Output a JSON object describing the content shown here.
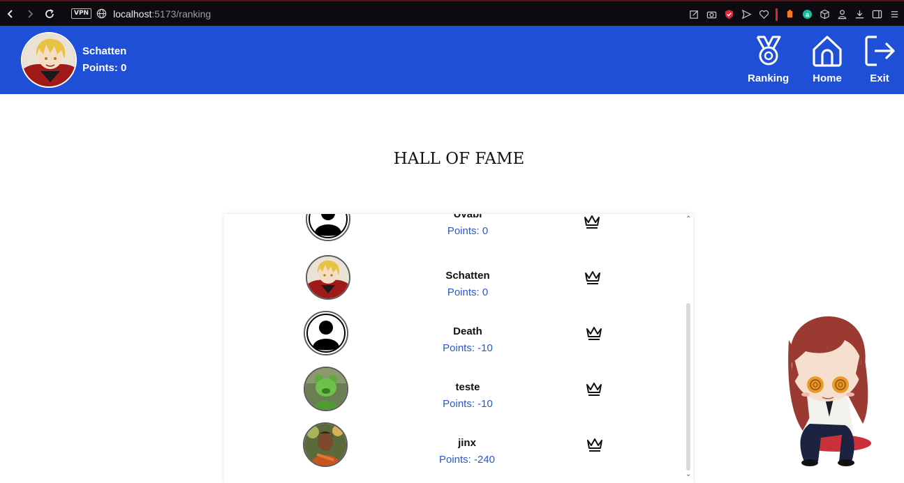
{
  "browser": {
    "vpn_label": "VPN",
    "url_host": "localhost",
    "url_path": ":5173/ranking"
  },
  "header": {
    "user_name": "Schatten",
    "user_points": "Points: 0",
    "nav": {
      "ranking": "Ranking",
      "home": "Home",
      "exit": "Exit"
    },
    "brand_color": "#1f4fd6"
  },
  "page": {
    "title": "HALL OF FAME"
  },
  "ranking": {
    "entries": [
      {
        "name": "Uvabi",
        "points": "Points: 0",
        "avatar": "default-silhouette"
      },
      {
        "name": "Schatten",
        "points": "Points: 0",
        "avatar": "anime-blond-boy"
      },
      {
        "name": "Death",
        "points": "Points: -10",
        "avatar": "default-silhouette"
      },
      {
        "name": "teste",
        "points": "Points: -10",
        "avatar": "green-creature"
      },
      {
        "name": "jinx",
        "points": "Points: -240",
        "avatar": "warrior-portrait"
      }
    ],
    "points_color": "#2a58c9"
  }
}
